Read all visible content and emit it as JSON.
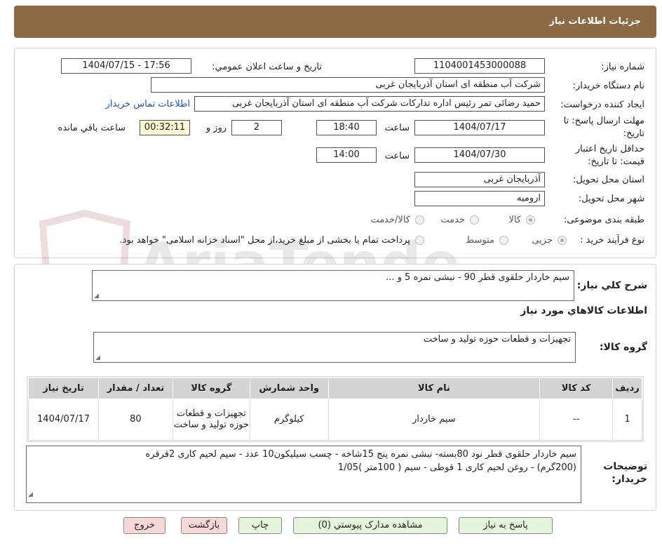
{
  "header": {
    "title": "جزئیات اطلاعات نیاز"
  },
  "watermark": {
    "text": "AriaTender.net"
  },
  "form": {
    "need_number_label": "شماره نیاز:",
    "need_number": "1104001453000088",
    "announce_label": "تاریخ و ساعت اعلان عمومي:",
    "announce_value": "1404/07/15 - 17:56",
    "buyer_org_label": "نام دستگاه خريدار:",
    "buyer_org": "شرکت آب منطقه ای استان آذربایجان غربی",
    "creator_label": "ایجاد کننده درخواست:",
    "creator": "حمید رضائی تمر رئیس اداره تداركات شرکت آب منطقه ای استان آذربایجان غربی",
    "contact_link": "اطلاعات تماس خريدار",
    "deadline_label_1": "مهلت ارسال پاسخ: تا",
    "deadline_label_2": "تاریخ:",
    "deadline_date": "1404/07/17",
    "time_label": "ساعت",
    "deadline_time": "18:40",
    "days_value": "2",
    "days_label": "روز و",
    "remaining_time": "00:32:11",
    "remaining_label": "ساعت باقي مانده",
    "validity_label_1": "حداقل تاریخ اعتبار",
    "validity_label_2": "قیمت: تا تاریخ:",
    "validity_date": "1404/07/30",
    "validity_time_label": "ساعت",
    "validity_time": "14:00",
    "province_label": "استان محل تحویل:",
    "province": "آذربایجان غربی",
    "city_label": "شهر محل تحویل:",
    "city": "ارومیه",
    "category_label": "طبقه بندی موضوعی:",
    "category_options": [
      "کالا",
      "خدمت",
      "کالا/خدمت"
    ],
    "process_label": "نوع فرآیند خرید :",
    "process_options": [
      "جزیی",
      "متوسط"
    ],
    "process_note": "پرداخت تمام یا بخشی از مبلغ خرید،از محل \"اسناد خزانه اسلامی\" خواهد بود."
  },
  "details": {
    "summary_label": "شرح کلي نیاز:",
    "summary": "سیم خاردار حلقوی قطر 90 - نبشی نمره 5 و ...",
    "goods_info_title": "اطلاعات کالاهاي مورد نیاز",
    "goods_group_label": "گروه کالا:",
    "goods_group": "تجهیزات و قطعات حوزه تولید و ساخت",
    "table": {
      "headers": [
        "ردیف",
        "کد کالا",
        "نام کالا",
        "واحد شمارش",
        "گروه کالا",
        "تعداد / مقدار",
        "تاریخ نیاز"
      ],
      "rows": [
        [
          "1",
          "--",
          "سیم خاردار",
          "کیلوگرم",
          "تجهیزات و قطعات حوزه تولید و ساخت",
          "80",
          "1404/07/17"
        ]
      ]
    },
    "buyer_notes_label_1": "توضیحات",
    "buyer_notes_label_2": "خریدار:",
    "buyer_notes_line1": "سیم خاردار حلقوی قطر نود 80بسته- نبشی نمره پنج 15شاخه - چسب سیلیکون10 عدد - سیم لحیم کاری 2قرقره",
    "buyer_notes_line2": "(200گرم) - روغن لحیم کاری 1 قوطی - سیم  ( 100متر )1/05"
  },
  "buttons": {
    "reply": "پاسخ به نیاز",
    "view_docs": "مشاهده مدارک پیوستي (0)",
    "print": "چاپ",
    "back": "بازگشت",
    "exit": "خروج"
  }
}
